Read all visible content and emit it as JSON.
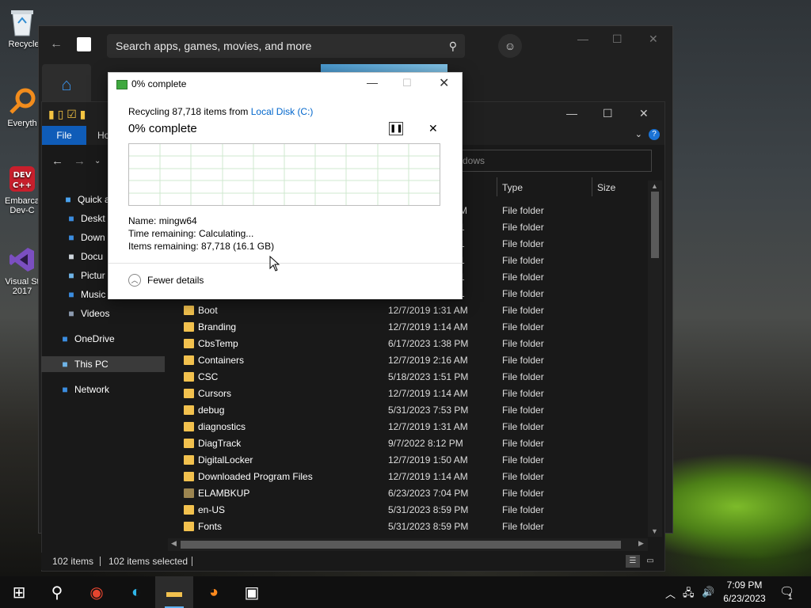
{
  "desktop": {
    "icons": [
      {
        "label": "Recycle",
        "icon": "recycle-bin-icon"
      },
      {
        "label": "Everyth",
        "icon": "everything-search-icon"
      },
      {
        "label": "Embarca Dev-C",
        "icon": "devcpp-icon"
      },
      {
        "label": "Visual St 2017",
        "icon": "visual-studio-icon"
      }
    ]
  },
  "store": {
    "search_placeholder": "Search apps, games, movies, and more"
  },
  "explorer": {
    "ribbon": {
      "file_tab": "File",
      "home_tab": "Ho"
    },
    "search_placeholder": "dows",
    "sidebar": [
      {
        "label": "Quick a",
        "icon": "star-icon",
        "color": "#4aa3f0"
      },
      {
        "label": "Deskt",
        "icon": "desktop-icon",
        "color": "#3b8de0"
      },
      {
        "label": "Down",
        "icon": "downloads-icon",
        "color": "#3b8de0"
      },
      {
        "label": "Docu",
        "icon": "documents-icon",
        "color": "#cfd6dd"
      },
      {
        "label": "Pictur",
        "icon": "pictures-icon",
        "color": "#6fb4e8"
      },
      {
        "label": "Music",
        "icon": "music-icon",
        "color": "#3b8de0"
      },
      {
        "label": "Videos",
        "icon": "videos-icon",
        "color": "#8d9bb0"
      },
      {
        "label": "OneDrive",
        "icon": "cloud-icon",
        "color": "#3b8de0"
      },
      {
        "label": "This PC",
        "icon": "computer-icon",
        "color": "#6fb4e8"
      },
      {
        "label": "Network",
        "icon": "network-icon",
        "color": "#3b8de0"
      }
    ],
    "columns": {
      "type": "Type",
      "size": "Size"
    },
    "partial_rows": [
      {
        "date": "M",
        "type": "File folder"
      },
      {
        "date": "1",
        "type": "File folder"
      },
      {
        "date": "1",
        "type": "File folder"
      },
      {
        "date": "1",
        "type": "File folder"
      },
      {
        "date": "1",
        "type": "File folder"
      },
      {
        "date": "1",
        "type": "File folder"
      }
    ],
    "rows": [
      {
        "name": "Boot",
        "date": "12/7/2019 1:31 AM",
        "type": "File folder"
      },
      {
        "name": "Branding",
        "date": "12/7/2019 1:14 AM",
        "type": "File folder"
      },
      {
        "name": "CbsTemp",
        "date": "6/17/2023 1:38 PM",
        "type": "File folder"
      },
      {
        "name": "Containers",
        "date": "12/7/2019 2:16 AM",
        "type": "File folder"
      },
      {
        "name": "CSC",
        "date": "5/18/2023 1:51 PM",
        "type": "File folder"
      },
      {
        "name": "Cursors",
        "date": "12/7/2019 1:14 AM",
        "type": "File folder"
      },
      {
        "name": "debug",
        "date": "5/31/2023 7:53 PM",
        "type": "File folder"
      },
      {
        "name": "diagnostics",
        "date": "12/7/2019 1:31 AM",
        "type": "File folder"
      },
      {
        "name": "DiagTrack",
        "date": "9/7/2022 8:12 PM",
        "type": "File folder"
      },
      {
        "name": "DigitalLocker",
        "date": "12/7/2019 1:50 AM",
        "type": "File folder"
      },
      {
        "name": "Downloaded Program Files",
        "date": "12/7/2019 1:14 AM",
        "type": "File folder"
      },
      {
        "name": "ELAMBKUP",
        "date": "6/23/2023 7:04 PM",
        "type": "File folder"
      },
      {
        "name": "en-US",
        "date": "5/31/2023 8:59 PM",
        "type": "File folder"
      },
      {
        "name": "Fonts",
        "date": "5/31/2023 8:59 PM",
        "type": "File folder"
      }
    ],
    "status": {
      "items": "102 items",
      "selected": "102 items selected"
    }
  },
  "dialog": {
    "title": "0% complete",
    "from_prefix": "Recycling 87,718 items from",
    "from_link": "Local Disk (C:)",
    "heading": "0% complete",
    "name_label": "Name:",
    "name_value": "mingw64",
    "time_label": "Time remaining:",
    "time_value": "Calculating...",
    "items_label": "Items remaining:",
    "items_value": "87,718 (16.1 GB)",
    "progress_fraction": 0,
    "fewer_details": "Fewer details"
  },
  "taskbar": {
    "apps": [
      {
        "name": "windows-start-icon",
        "glyph": "⊞"
      },
      {
        "name": "search-icon",
        "glyph": "⚲"
      },
      {
        "name": "chrome-icon",
        "glyph": "◉"
      },
      {
        "name": "edge-icon",
        "glyph": "◐"
      },
      {
        "name": "file-explorer-icon",
        "glyph": "▬"
      },
      {
        "name": "firefox-icon",
        "glyph": "◕"
      },
      {
        "name": "store-icon",
        "glyph": "▣"
      }
    ],
    "time": "7:09 PM",
    "date": "6/23/2023",
    "notification_count": "1"
  }
}
